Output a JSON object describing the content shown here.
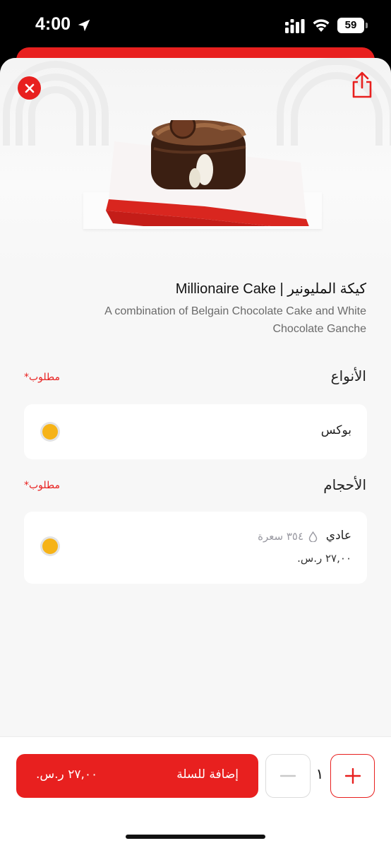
{
  "status_bar": {
    "time": "4:00",
    "battery": "59"
  },
  "product": {
    "title": "Millionaire Cake | كيكة المليونير",
    "description": "A combination of Belgain Chocolate Cake and White Chocolate Ganche"
  },
  "sections": {
    "types": {
      "title": "الأنواع",
      "required": "مطلوب*",
      "option": {
        "label": "بوكس"
      }
    },
    "sizes": {
      "title": "الأحجام",
      "required": "مطلوب*",
      "option": {
        "label": "عادي",
        "calories": "٣٥٤ سعرة",
        "price": "٢٧,٠٠ ر.س."
      }
    }
  },
  "cart": {
    "add_label": "إضافة للسلة",
    "price": "٢٧,٠٠ ر.س.",
    "quantity": "١"
  },
  "colors": {
    "accent": "#e8201f",
    "radio": "#f6b318",
    "background": "#f7f7f7"
  },
  "icons": [
    "location-arrow-icon",
    "signal-icon",
    "wifi-icon",
    "close-icon",
    "share-icon",
    "calorie-drop-icon",
    "minus-icon",
    "plus-icon"
  ]
}
